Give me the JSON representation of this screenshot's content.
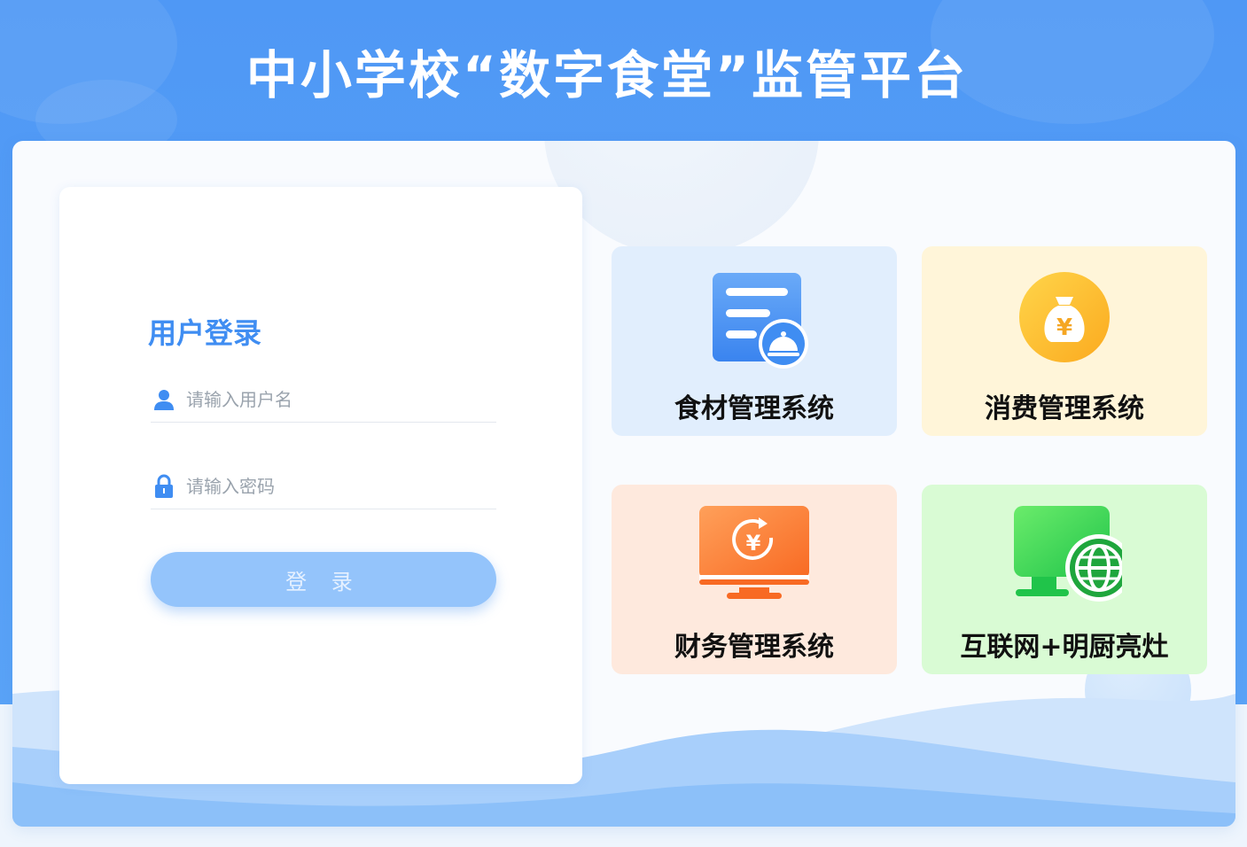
{
  "page": {
    "title": "中小学校“数字食堂”监管平台"
  },
  "login": {
    "title": "用户登录",
    "username_placeholder": "请输入用户名",
    "password_placeholder": "请输入密码",
    "submit_label": "登 录"
  },
  "systems": [
    {
      "label": "食材管理系统",
      "icon": "food-menu-icon",
      "bg": "#e1eefd"
    },
    {
      "label": "消费管理系统",
      "icon": "money-bag-icon",
      "bg": "#fff5d9"
    },
    {
      "label": "财务管理系统",
      "icon": "finance-monitor-icon",
      "bg": "#fee9dd"
    },
    {
      "label": "互联网+明厨亮灶",
      "icon": "internet-kitchen-icon",
      "bg": "#d9fbd4"
    }
  ],
  "colors": {
    "primary": "#3f8df2",
    "header_bg": "#4f98f5",
    "button": "#94c4fb"
  }
}
